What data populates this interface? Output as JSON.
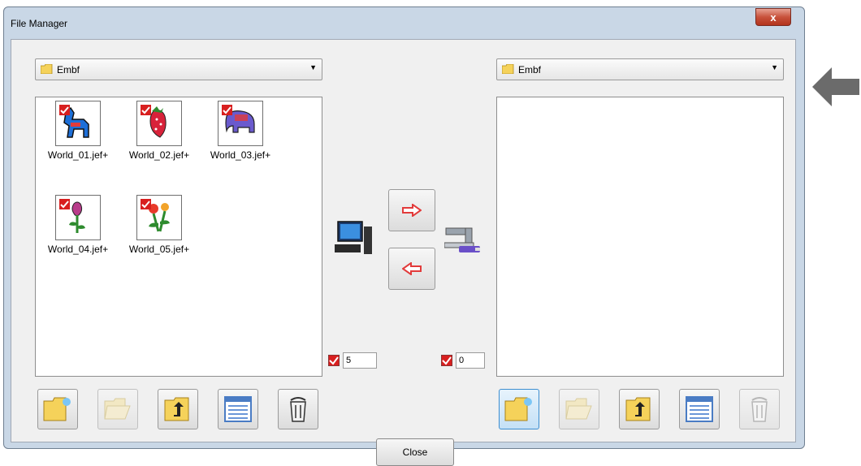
{
  "window": {
    "title": "File Manager",
    "close_glyph": "x"
  },
  "left_pane": {
    "folder": "Embf",
    "files": [
      {
        "name": "World_01.jef+",
        "icon": "horse-design-icon",
        "checked": true
      },
      {
        "name": "World_02.jef+",
        "icon": "strawberry-design-icon",
        "checked": true
      },
      {
        "name": "World_03.jef+",
        "icon": "elephant-design-icon",
        "checked": true
      },
      {
        "name": "World_04.jef+",
        "icon": "tulip-design-icon",
        "checked": true
      },
      {
        "name": "World_05.jef+",
        "icon": "flower-design-icon",
        "checked": true
      }
    ],
    "selected_count": "5"
  },
  "right_pane": {
    "folder": "Embf",
    "files": [],
    "selected_count": "0"
  },
  "close_button": "Close",
  "colors": {
    "arrow_red": "#e23b3b",
    "accent_blue": "#3d8ed0",
    "big_arrow": "#6b6b6b"
  }
}
